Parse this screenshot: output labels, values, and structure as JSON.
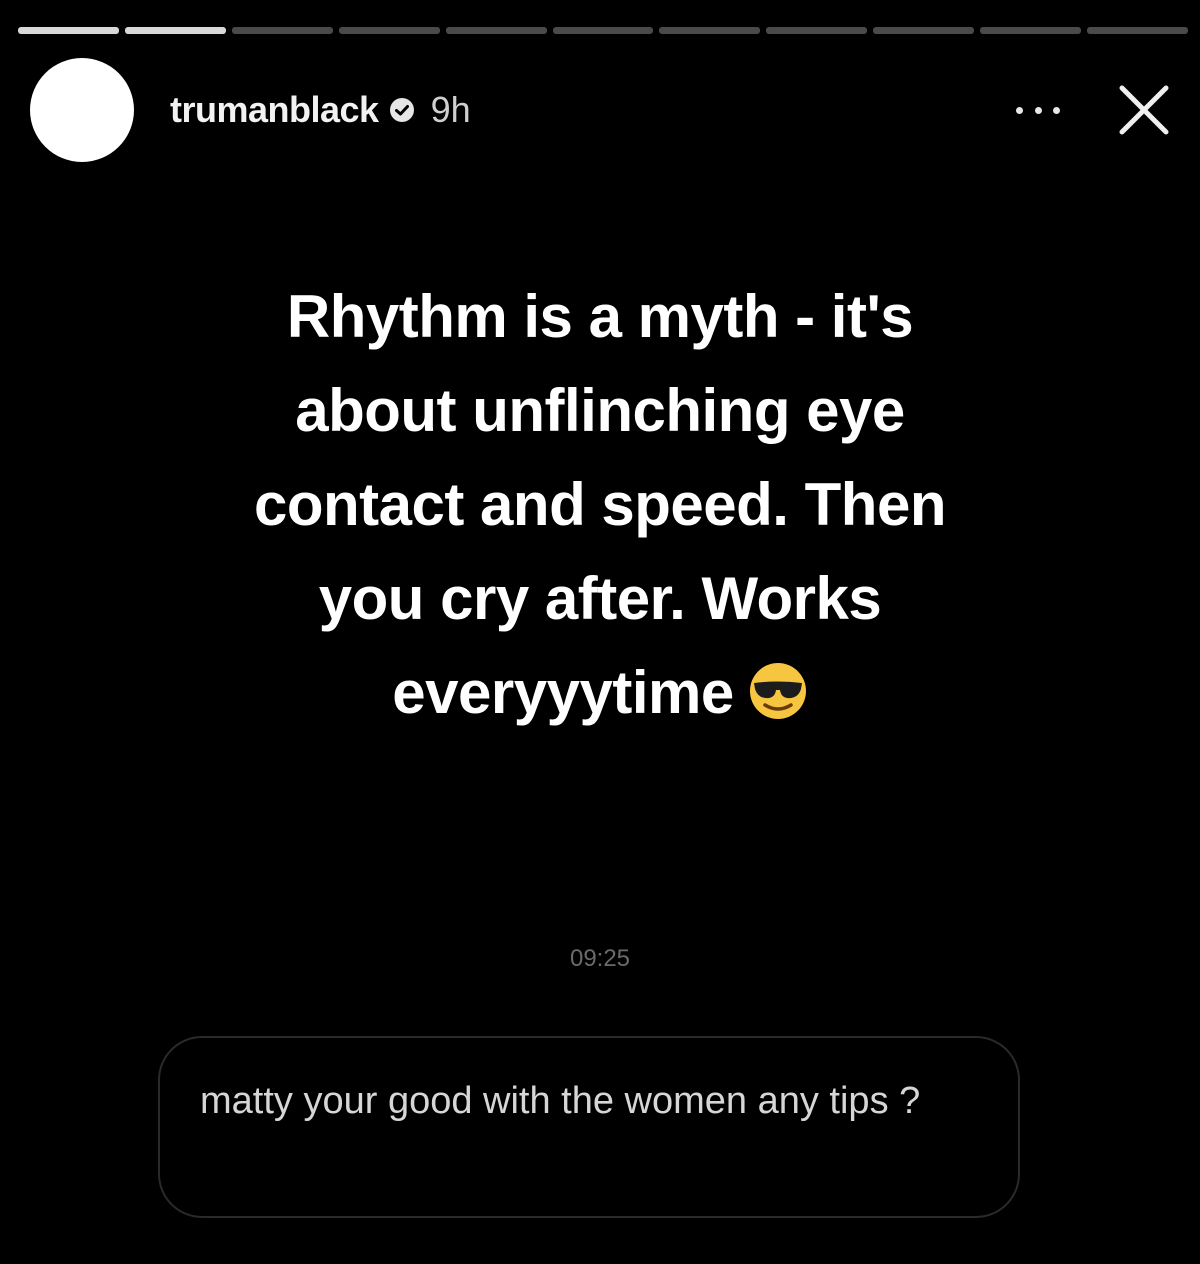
{
  "story": {
    "segments_total": 11,
    "segments_seen": 2,
    "username": "trumanblack",
    "time_ago": "9h",
    "lines": [
      "Rhythm is a myth - it's",
      "about unflinching eye",
      "contact and speed. Then",
      "you cry after. Works",
      "everyyytime"
    ],
    "emoji": "smiling-face-with-sunglasses"
  },
  "reply": {
    "timestamp": "09:25",
    "message": "matty your good with the women any tips ?"
  },
  "colors": {
    "background": "#000000",
    "text": "#ffffff",
    "muted": "#6a6a6a"
  }
}
